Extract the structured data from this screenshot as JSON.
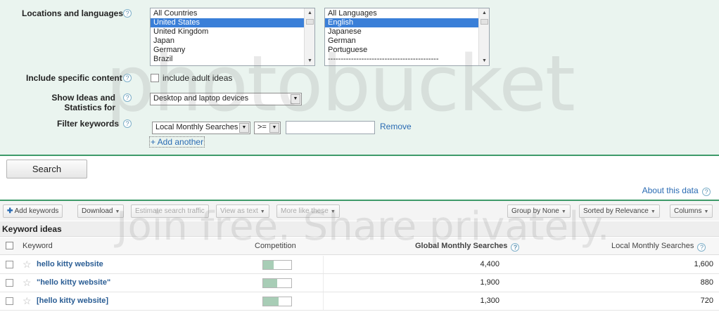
{
  "settings": {
    "locations_label": "Locations and languages",
    "countries": [
      "All Countries",
      "United States",
      "United Kingdom",
      "Japan",
      "Germany",
      "Brazil"
    ],
    "countries_selected": "United States",
    "languages": [
      "All Languages",
      "English",
      "Japanese",
      "German",
      "Portuguese",
      "-------------------------------------------"
    ],
    "languages_selected": "English",
    "include_label": "Include specific content",
    "include_adult_label": "include adult ideas",
    "show_ideas_label_1": "Show Ideas and",
    "show_ideas_label_2": "Statistics for",
    "device_value": "Desktop and laptop devices",
    "filter_label": "Filter keywords",
    "filter_metric": "Local Monthly Searches",
    "filter_operator": ">=",
    "filter_value": "",
    "remove_link": "Remove",
    "add_another": "+ Add another",
    "help_glyph": "?"
  },
  "search_button": "Search",
  "about_data": "About this data",
  "toolbar": {
    "add_keywords": "Add keywords",
    "download": "Download",
    "estimate": "Estimate search traffic",
    "view_as_text": "View as text",
    "more_like_these": "More like these",
    "group_by": "Group by None",
    "sorted_by": "Sorted by Relevance",
    "columns": "Columns"
  },
  "section_title": "Keyword ideas",
  "table": {
    "headers": {
      "keyword": "Keyword",
      "competition": "Competition",
      "global": "Global Monthly Searches",
      "local": "Local Monthly Searches"
    },
    "rows": [
      {
        "keyword": "hello kitty website",
        "competition": 0.38,
        "global": "4,400",
        "local": "1,600"
      },
      {
        "keyword": "\"hello kitty website\"",
        "competition": 0.5,
        "global": "1,900",
        "local": "880"
      },
      {
        "keyword": "[hello kitty website]",
        "competition": 0.55,
        "global": "1,300",
        "local": "720"
      }
    ]
  },
  "watermark": {
    "logo_text": "photobucket",
    "tagline": "Join free. Share privately."
  },
  "colors": {
    "accent_green": "#3e9a6a",
    "panel_bg": "#eaf4ef",
    "link_blue": "#2a6bb3",
    "selection_blue": "#3a7fd8",
    "competition_fill": "#a8cdb6"
  }
}
